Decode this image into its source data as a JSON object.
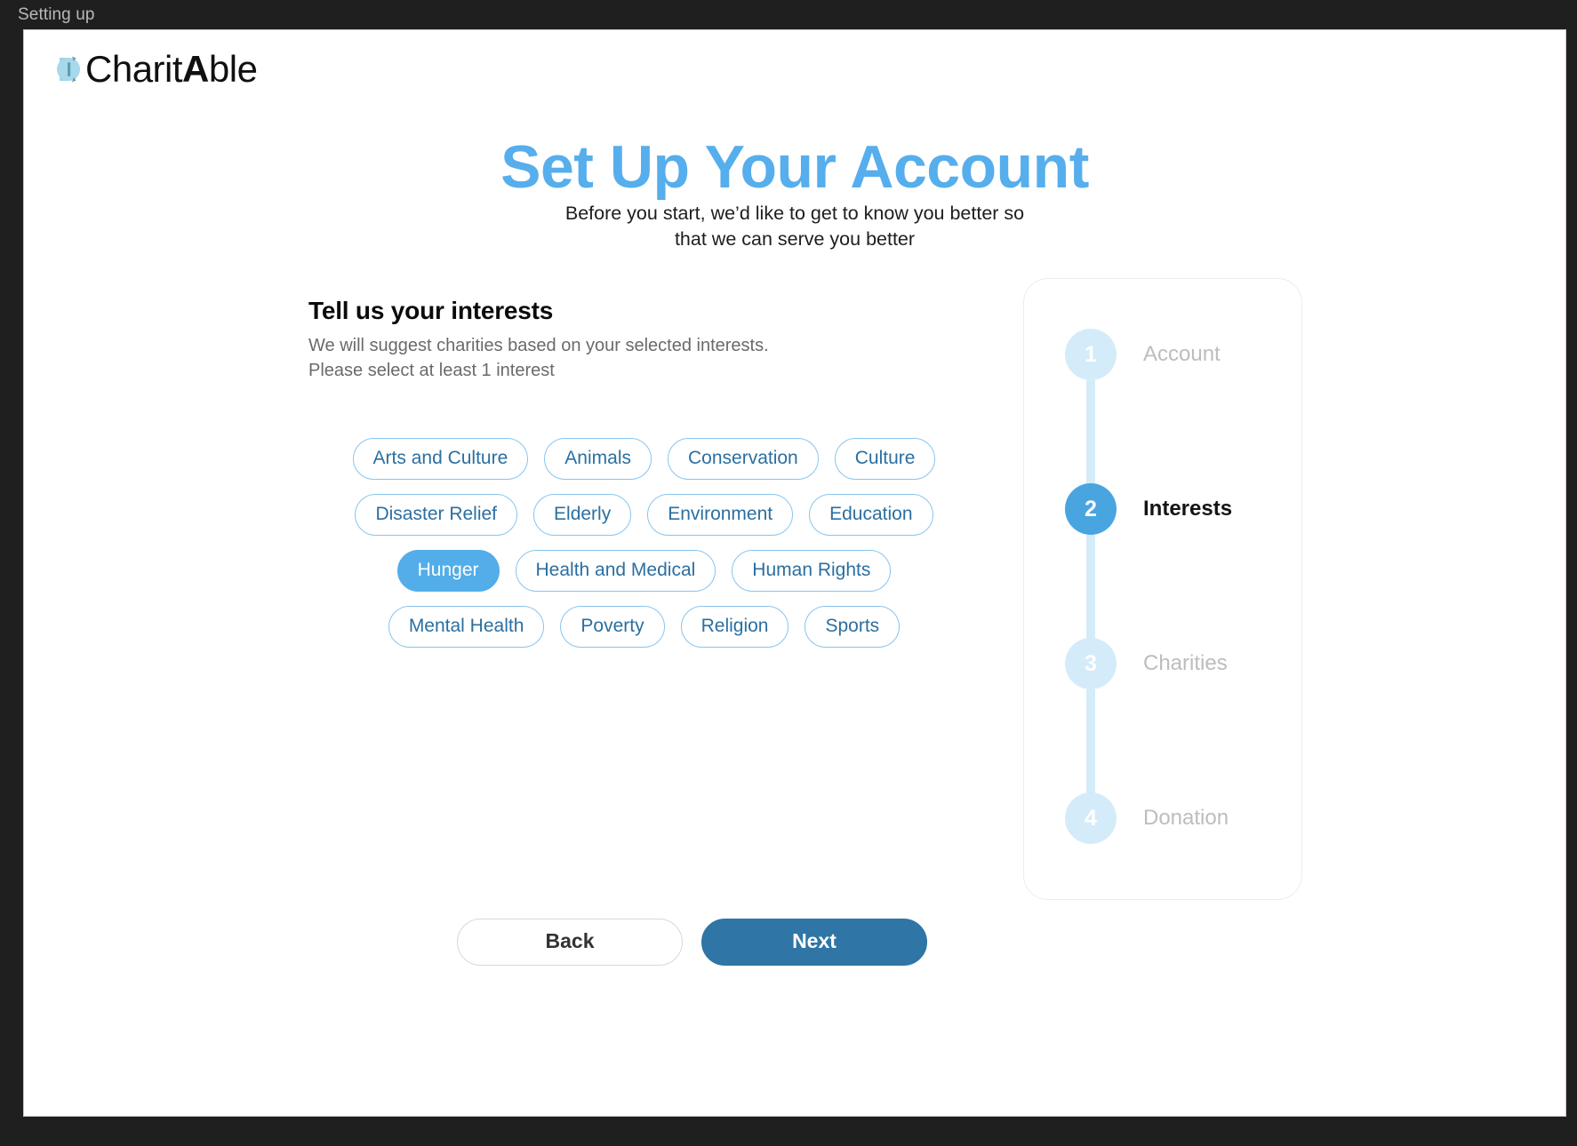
{
  "window": {
    "title": "Setting up"
  },
  "brand": {
    "logo_icon": "charitable-hand-logo-icon",
    "name_light": "Charit",
    "name_bold": "A",
    "name_tail": "ble"
  },
  "page": {
    "headline": "Set Up Your Account",
    "subhead_line1": "Before you start, we’d like to get to know you better so",
    "subhead_line2": "that we can serve you better"
  },
  "interests_section": {
    "title": "Tell us your interests",
    "desc_line1": "We will suggest charities based on your selected interests.",
    "desc_line2": "Please select at least 1 interest",
    "rows": [
      [
        {
          "label": "Arts and Culture",
          "selected": false
        },
        {
          "label": "Animals",
          "selected": false
        },
        {
          "label": "Conservation",
          "selected": false
        },
        {
          "label": "Culture",
          "selected": false
        }
      ],
      [
        {
          "label": "Disaster Relief",
          "selected": false
        },
        {
          "label": "Elderly",
          "selected": false
        },
        {
          "label": "Environment",
          "selected": false
        },
        {
          "label": "Education",
          "selected": false
        }
      ],
      [
        {
          "label": "Hunger",
          "selected": true
        },
        {
          "label": "Health and Medical",
          "selected": false
        },
        {
          "label": "Human Rights",
          "selected": false
        }
      ],
      [
        {
          "label": "Mental Health",
          "selected": false
        },
        {
          "label": "Poverty",
          "selected": false
        },
        {
          "label": "Religion",
          "selected": false
        },
        {
          "label": "Sports",
          "selected": false
        }
      ]
    ]
  },
  "actions": {
    "back_label": "Back",
    "next_label": "Next"
  },
  "stepper": {
    "steps": [
      {
        "number": "1",
        "label": "Account",
        "active": false
      },
      {
        "number": "2",
        "label": "Interests",
        "active": true
      },
      {
        "number": "3",
        "label": "Charities",
        "active": false
      },
      {
        "number": "4",
        "label": "Donation",
        "active": false
      }
    ]
  },
  "colors": {
    "accent_light": "#56aeec",
    "accent_chip_selected": "#52ade9",
    "accent_next_button": "#2f75a5",
    "step_inactive": "#d4ecf9",
    "step_active": "#49a5e0",
    "chip_border": "#86c5ef",
    "chip_text": "#2b6fa0",
    "titlebar_bg": "#1f1f1f"
  }
}
